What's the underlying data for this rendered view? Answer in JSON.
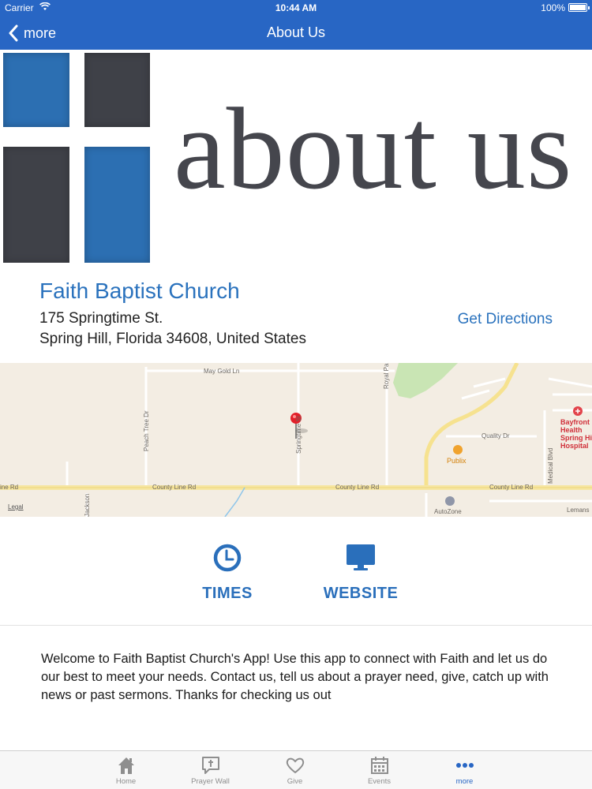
{
  "status_bar": {
    "carrier": "Carrier",
    "time": "10:44 AM",
    "battery": "100%"
  },
  "nav": {
    "back_label": "more",
    "title": "About Us"
  },
  "banner": {
    "headline": "about us",
    "colors": {
      "blue": "#2c6fb2",
      "dark": "#3f4148"
    }
  },
  "church": {
    "name": "Faith Baptist Church",
    "address_line1": "175 Springtime St.",
    "address_line2": "Spring Hill, Florida 34608, United States",
    "directions_label": "Get Directions"
  },
  "map": {
    "streets": {
      "may_gold": "May Gold Ln",
      "peach_tree": "Peach Tree Dr",
      "royal_palm": "Royal Pa",
      "springtime": "Springtime St",
      "quality": "Quality Dr",
      "county_line_left": "ine Rd",
      "county_line_1": "County Line Rd",
      "county_line_2": "County Line Rd",
      "county_line_3": "County Line Rd",
      "medical": "Medical Blvd",
      "jackson": "Jackson",
      "lemans": "Lemans"
    },
    "pois": {
      "publix": "Publix",
      "autozone": "AutoZone",
      "hospital": "Bayfront Health Spring Hill Hospital"
    },
    "legal": "Legal"
  },
  "actions": {
    "times_label": "TIMES",
    "website_label": "WEBSITE"
  },
  "description": "Welcome to Faith Baptist Church's App! Use this app to connect with Faith and let us do our best to meet your needs. Contact us, tell us about a prayer need, give, catch up with news or past sermons. Thanks for checking us out",
  "tabs": [
    {
      "label": "Home",
      "icon": "home-icon"
    },
    {
      "label": "Prayer Wall",
      "icon": "prayer-wall-icon"
    },
    {
      "label": "Give",
      "icon": "heart-icon"
    },
    {
      "label": "Events",
      "icon": "calendar-icon"
    },
    {
      "label": "more",
      "icon": "more-dots-icon",
      "active": true
    }
  ],
  "colors": {
    "nav_bar": "#2866c4",
    "accent": "#2a72bd",
    "tab_inactive": "#8e8e8e"
  }
}
